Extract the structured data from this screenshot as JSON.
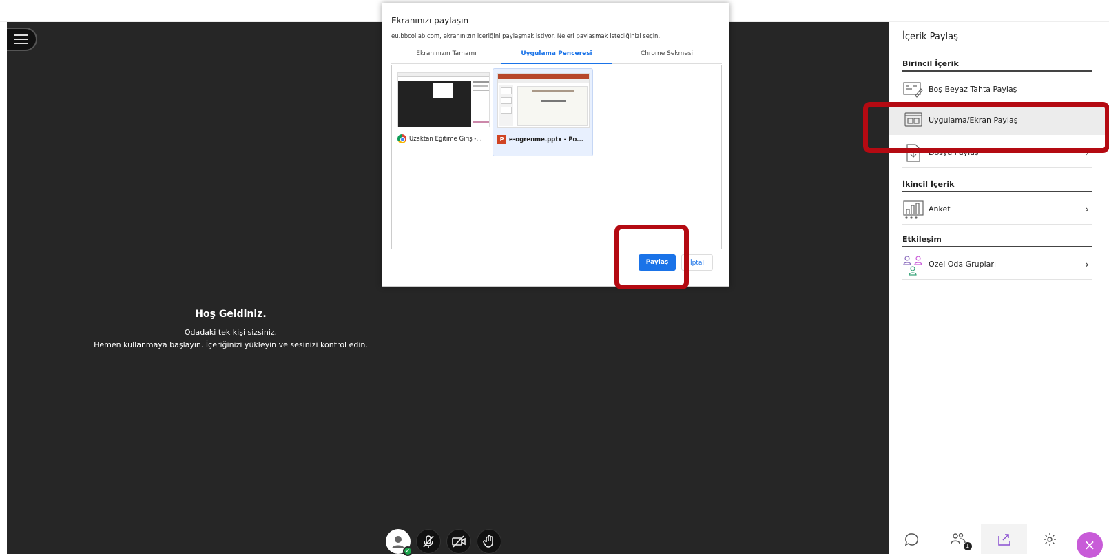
{
  "dialog": {
    "title": "Ekranınızı paylaşın",
    "description": "eu.bbcollab.com, ekranınızın içeriğini paylaşmak istiyor. Neleri paylaşmak istediğinizi seçin.",
    "tabs": [
      {
        "label": "Ekranınızın Tamamı",
        "active": false
      },
      {
        "label": "Uygulama Penceresi",
        "active": true
      },
      {
        "label": "Chrome Sekmesi",
        "active": false
      }
    ],
    "windows": [
      {
        "title": "Uzaktan Eğitime Giriş -...",
        "icon": "chrome-icon",
        "selected": false
      },
      {
        "title": "e-ogrenme.pptx - Po...",
        "icon": "powerpoint-icon",
        "selected": true
      }
    ],
    "share_label": "Paylaş",
    "cancel_label": "İptal"
  },
  "welcome": {
    "title": "Hoş Geldiniz.",
    "line1": "Odadaki tek kişi sizsiniz.",
    "line2": "Hemen kullanmaya başlayın. İçeriğinizi yükleyin ve sesinizi kontrol edin."
  },
  "panel": {
    "title": "İçerik Paylaş",
    "sections": [
      {
        "heading": "Birincil İçerik",
        "items": [
          {
            "label": "Boş Beyaz Tahta Paylaş",
            "icon": "whiteboard-icon",
            "chevron": false
          },
          {
            "label": "Uygulama/Ekran Paylaş",
            "icon": "app-screen-icon",
            "chevron": false,
            "highlighted": true
          },
          {
            "label": "Dosya Paylaş",
            "icon": "file-icon",
            "chevron": true
          }
        ]
      },
      {
        "heading": "İkincil İçerik",
        "items": [
          {
            "label": "Anket",
            "icon": "poll-icon",
            "chevron": true
          }
        ]
      },
      {
        "heading": "Etkileşim",
        "items": [
          {
            "label": "Özel Oda Grupları",
            "icon": "breakout-groups-icon",
            "chevron": true
          }
        ]
      }
    ],
    "attendee_count": "1"
  },
  "colors": {
    "highlight": "#b40a12",
    "accent": "#1a73e8",
    "close_fab": "#c85bd8",
    "stage": "#262626"
  }
}
